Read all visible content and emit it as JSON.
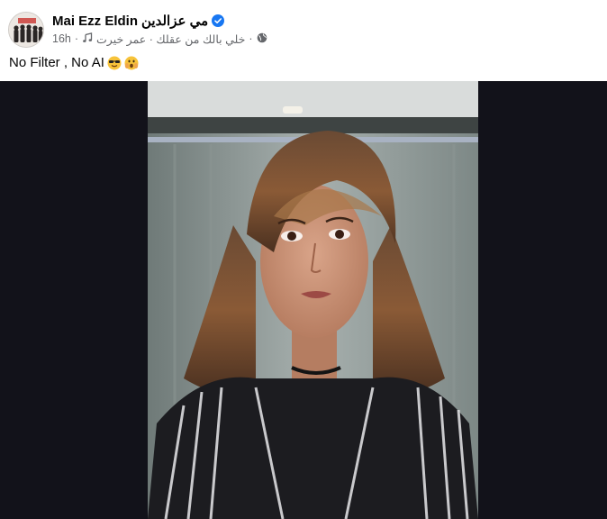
{
  "post": {
    "author_name": "Mai Ezz Eldin",
    "author_name_arabic": "مي عزالدين",
    "verified_icon": "verified-badge-icon",
    "time": "16h",
    "music_icon": "music-note-icon",
    "song": "خلي بالك من عقلك · عمر خيرت",
    "privacy_icon": "globe-icon",
    "separator": "·",
    "text": "No Filter , No AI",
    "emojis": [
      "cool-face-emoji",
      "surprised-face-emoji"
    ]
  },
  "colors": {
    "verified_blue": "#1877f2",
    "meta_gray": "#65676b",
    "media_background": "#12121a"
  }
}
